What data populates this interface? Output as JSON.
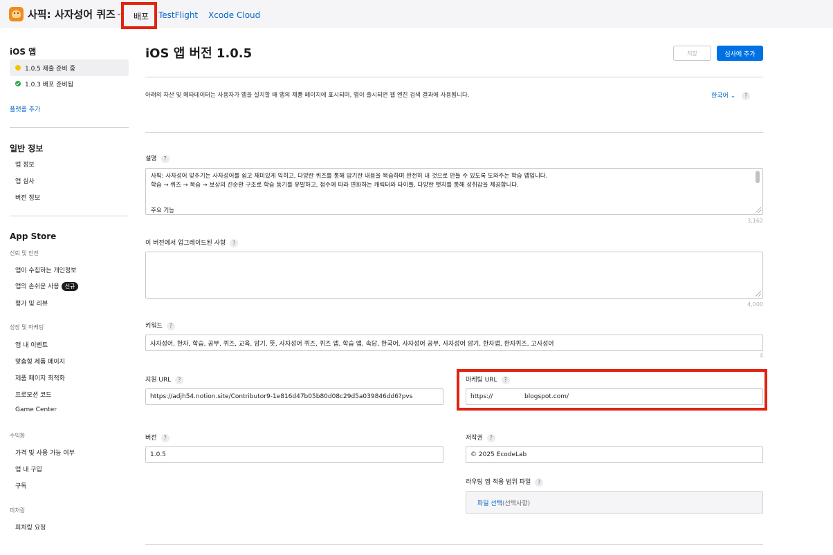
{
  "topbar": {
    "app_name": "사픽: 사자성어 퀴즈",
    "chevron": "⌄",
    "tabs": [
      {
        "label": "배포"
      },
      {
        "label": "TestFlight"
      },
      {
        "label": "Xcode Cloud"
      }
    ]
  },
  "sidebar": {
    "ios_heading": "iOS 앱",
    "versions": [
      {
        "label": "1.0.5 제출 준비 중",
        "status_color": "#f5c400"
      },
      {
        "label": "1.0.3 배포 준비됨",
        "status_color": "#2aa54a"
      }
    ],
    "add_platform": "플랫폼 추가",
    "general_heading": "일반 정보",
    "general_items": [
      "앱 정보",
      "앱 심사",
      "버전 정보"
    ],
    "appstore_heading": "App Store",
    "trust_label": "신뢰 및 안전",
    "trust_items": [
      "앱이 수집하는 개인정보",
      "앱의 손쉬운 사용",
      "평가 및 리뷰"
    ],
    "new_badge": "신규",
    "growth_label": "성장 및 마케팅",
    "growth_items": [
      "앱 내 이벤트",
      "맞춤형 제품 페이지",
      "제품 페이지 최적화",
      "프로모션 코드",
      "Game Center"
    ],
    "monetize_label": "수익화",
    "monetize_items": [
      "가격 및 사용 가능 여부",
      "앱 내 구입",
      "구독"
    ],
    "featuring_label": "피처링",
    "featuring_items": [
      "피처링 요청"
    ]
  },
  "main": {
    "title": "iOS 앱 버전 1.0.5",
    "save_label": "저장",
    "review_label": "심사에 추가",
    "intro": "아래의 자산 및 메타데이터는 사용자가 앱을 설치할 때 앱의 제품 페이지에 표시되며, 앱이 출시되면 웹 엔진 검색 결과에 사용됩니다.",
    "language": "한국어 ⌄",
    "help": "?",
    "description": {
      "label": "설명",
      "text": "사픽: 사자성어 맞추기는 사자성어를 쉽고 재미있게 익히고, 다양한 퀴즈를 통해 암기한 내용을 복습하며 완전히 내 것으로 만들 수 있도록 도와주는 학습 앱입니다.\n학습 → 퀴즈 → 복습 → 보상의 선순환 구조로 학습 동기를 유발하고, 점수에 따라 변화하는 캐릭터와 타이틀, 다양한 뱃지를 통해 성취감을 제공합니다.\n\n\n주요 기능",
      "counter": "3,162"
    },
    "whats_new": {
      "label": "이 버전에서 업그레이드된 사항",
      "text": "",
      "counter": "4,000"
    },
    "keywords": {
      "label": "키워드",
      "value": "사자성어, 한자, 학습, 공부, 퀴즈, 교육, 암기, 뜻, 사자성어 퀴즈, 퀴즈 앱, 학습 앱, 속담, 한국어, 사자성어 공부, 사자성어 암기, 한자앱, 한자퀴즈, 고사성어",
      "counter": "4"
    },
    "support_url": {
      "label": "지원 URL",
      "value": "https://adjh54.notion.site/Contributor9-1e816d47b05b80d08c29d5a039846dd6?pvs"
    },
    "marketing_url": {
      "label": "마케팅 URL",
      "value": "https://                blogspot.com/"
    },
    "version": {
      "label": "버전",
      "value": "1.0.5"
    },
    "copyright": {
      "label": "저작권",
      "value": "© 2025 EcodeLab"
    },
    "routing": {
      "label": "라우팅 앱 적용 범위 파일",
      "file_link": "파일 선택",
      "optional": "(선택사항)"
    }
  },
  "highlight_color": "#e0240f"
}
